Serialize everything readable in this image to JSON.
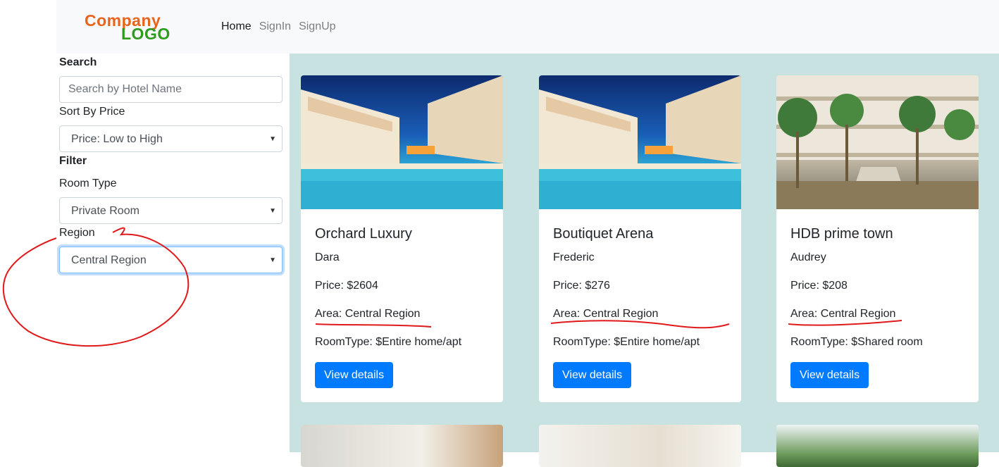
{
  "logo": {
    "line1": "Company",
    "line2": "LOGO"
  },
  "nav": {
    "home": "Home",
    "signin": "SignIn",
    "signup": "SignUp"
  },
  "sidebar": {
    "search_heading": "Search",
    "search_placeholder": "Search by Hotel Name",
    "sort_label": "Sort By Price",
    "sort_value": "Price: Low to High",
    "filter_heading": "Filter",
    "room_type_label": "Room Type",
    "room_type_value": "Private Room",
    "region_label": "Region",
    "region_value": "Central Region"
  },
  "cards": [
    {
      "name": "Orchard Luxury",
      "host": "Dara",
      "price": "Price: $2604",
      "area": "Area: Central Region",
      "room_type": "RoomType: $Entire home/apt",
      "button": "View details"
    },
    {
      "name": "Boutiquet Arena",
      "host": "Frederic",
      "price": "Price: $276",
      "area": "Area: Central Region",
      "room_type": "RoomType: $Entire home/apt",
      "button": "View details"
    },
    {
      "name": "HDB prime town",
      "host": "Audrey",
      "price": "Price: $208",
      "area": "Area: Central Region",
      "room_type": "RoomType: $Shared room",
      "button": "View details"
    }
  ],
  "colors": {
    "primary": "#007bff",
    "main_bg": "#c8e2e2",
    "annotation": "#e0191b",
    "logo_orange": "#e8641c",
    "logo_green": "#2e9b1f"
  }
}
